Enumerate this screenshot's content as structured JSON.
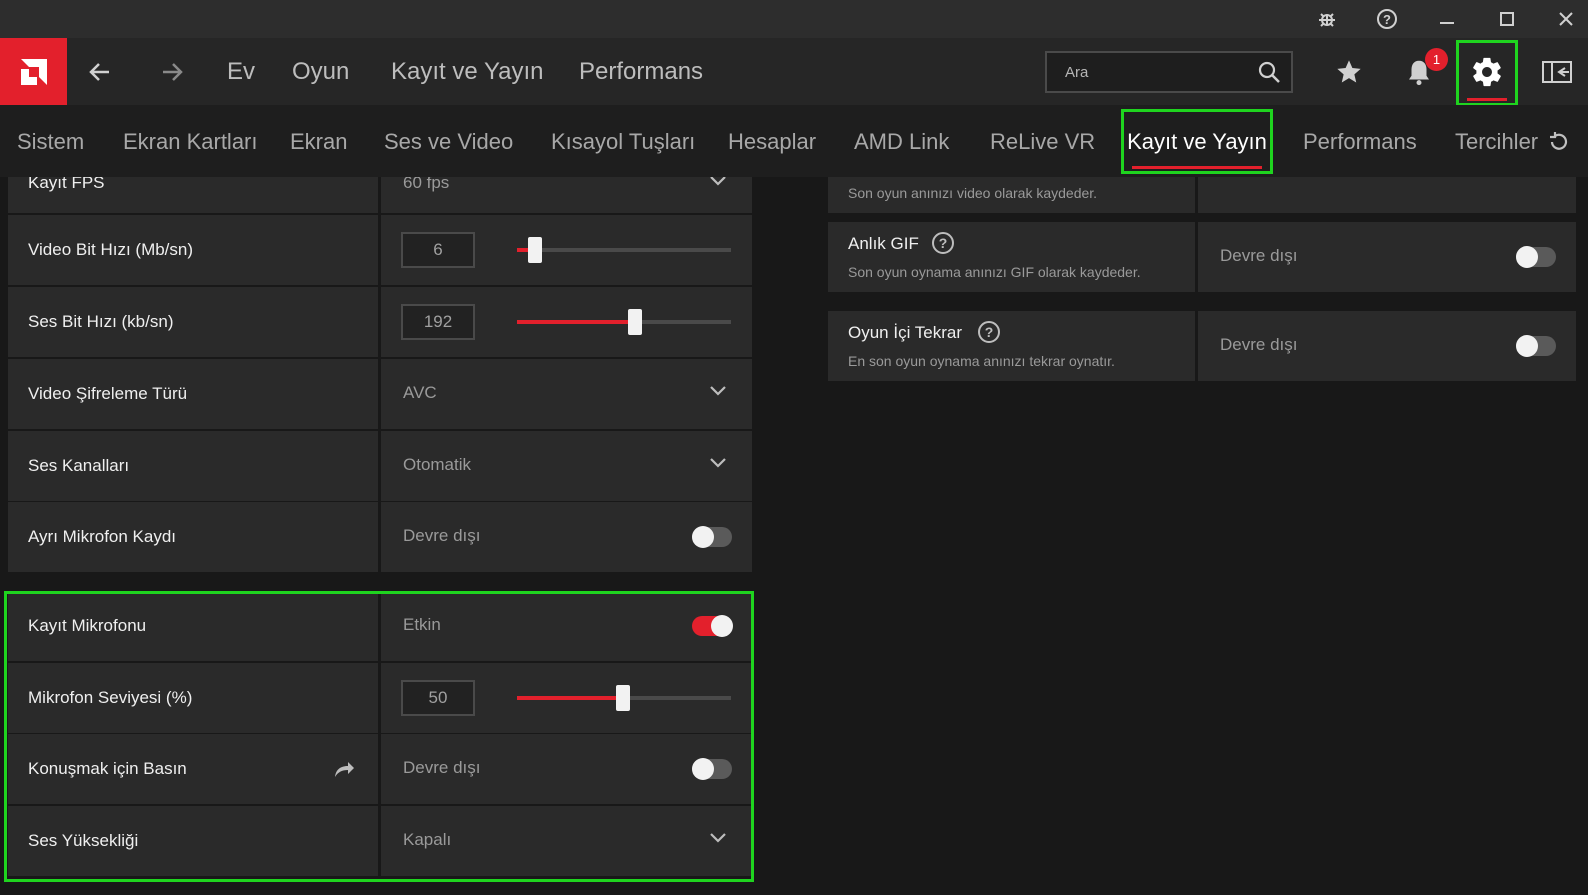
{
  "titlebar": {
    "icons": [
      "bug-icon",
      "help-icon",
      "minimize-icon",
      "maximize-icon",
      "close-icon"
    ]
  },
  "topnav": {
    "links": [
      "Ev",
      "Oyun",
      "Kayıt ve Yayın",
      "Performans"
    ],
    "search_placeholder": "Ara",
    "notification_count": "1"
  },
  "subnav": {
    "tabs": [
      "Sistem",
      "Ekran Kartları",
      "Ekran",
      "Ses ve Video",
      "Kısayol Tuşları",
      "Hesaplar",
      "AMD Link",
      "ReLive VR",
      "Kayıt ve Yayın",
      "Performans",
      "Tercihler"
    ],
    "active": "Kayıt ve Yayın"
  },
  "left_settings": {
    "partial_row": {
      "label": "Kayıt FPS",
      "value": "60 fps"
    },
    "rows": [
      {
        "label": "Video Bit Hızı (Mb/sn)",
        "value": "6",
        "slider_fraction": 0.08
      },
      {
        "label": "Ses Bit Hızı (kb/sn)",
        "value": "192",
        "slider_fraction": 0.55
      },
      {
        "label": "Video Şifreleme Türü",
        "value": "AVC"
      },
      {
        "label": "Ses Kanalları",
        "value": "Otomatik"
      },
      {
        "label": "Ayrı Mikrofon Kaydı",
        "value": "Devre dışı",
        "enabled": false
      },
      {
        "label": "Kayıt Mikrofonu",
        "value": "Etkin",
        "enabled": true
      },
      {
        "label": "Mikrofon Seviyesi (%)",
        "value": "50",
        "slider_fraction": 0.5
      },
      {
        "label": "Konuşmak için Basın",
        "value": "Devre dışı",
        "enabled": false
      },
      {
        "label": "Ses Yüksekliği",
        "value": "Kapalı"
      }
    ]
  },
  "right_settings": {
    "partial_desc": "Son oyun anınızı video olarak kaydeder.",
    "rows": [
      {
        "title": "Anlık GIF",
        "desc": "Son oyun oynama anınızı GIF olarak kaydeder.",
        "value": "Devre dışı",
        "enabled": false
      },
      {
        "title": "Oyun İçi Tekrar",
        "desc": "En son oyun oynama anınızı tekrar oynatır.",
        "value": "Devre dışı",
        "enabled": false
      }
    ]
  },
  "colors": {
    "accent": "#e3202c",
    "highlight": "#1fd41f"
  }
}
